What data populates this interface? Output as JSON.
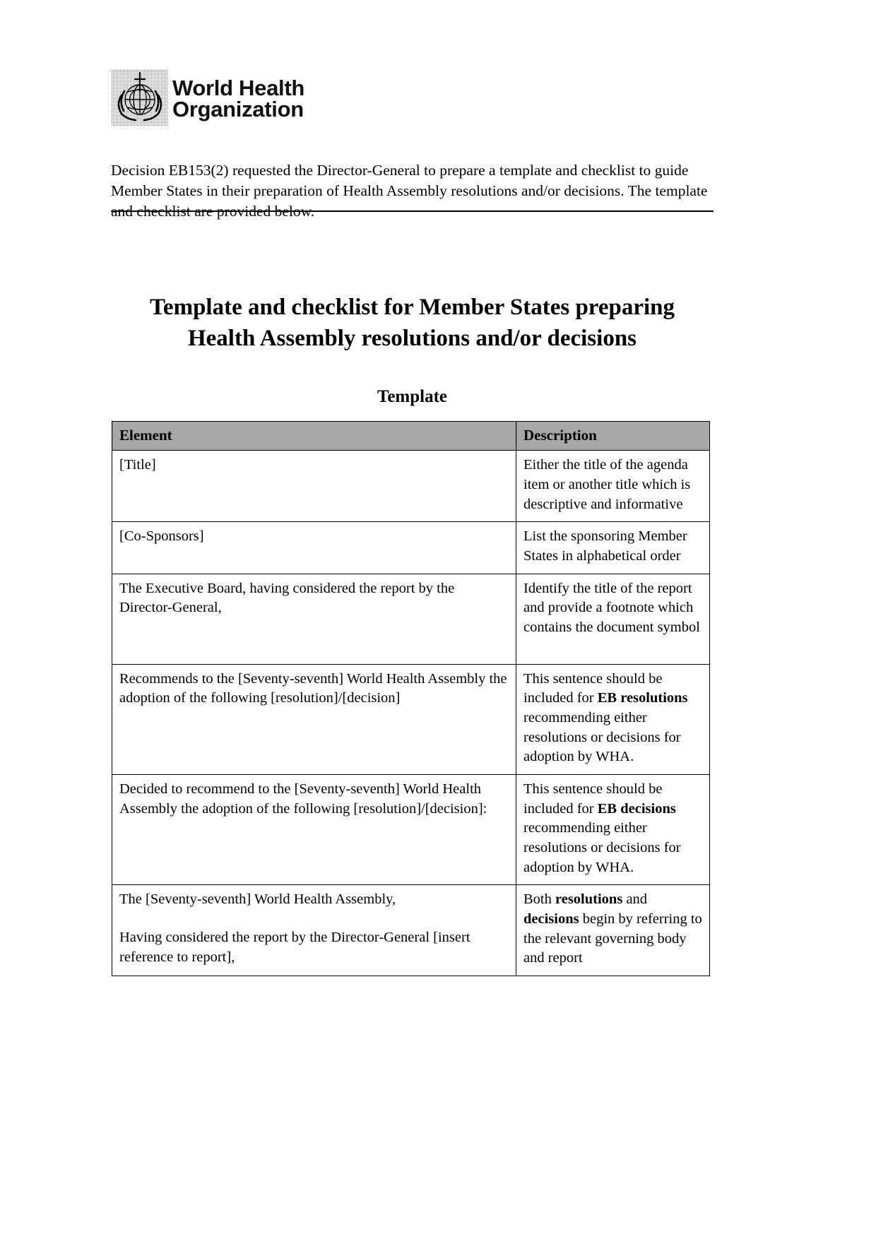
{
  "logo": {
    "emblem_name": "who-emblem",
    "line1": "World Health",
    "line2": "Organization"
  },
  "intro": {
    "paragraph": "Decision EB153(2) requested the Director-General to prepare a template and checklist to guide Member States in their preparation of Health Assembly resolutions and/or decisions. The template and checklist are provided below."
  },
  "title": {
    "line1": "Template and checklist for Member States preparing",
    "line2": "Health Assembly resolutions and/or decisions"
  },
  "subtitle": "Template",
  "table": {
    "headers": {
      "element": "Element",
      "description": "Description"
    },
    "rows": [
      {
        "element": "[Title]",
        "description_pre": "Either the title of the agenda item or another title which is descriptive and informative",
        "description_bold": "",
        "description_post": ""
      },
      {
        "element": "[Co-Sponsors]",
        "description_pre": "List the sponsoring Member States in alphabetical order",
        "description_bold": "",
        "description_post": ""
      },
      {
        "element": "The Executive Board, having considered the report by the Director-General,",
        "description_pre": "Identify the title of the report and provide a footnote which contains the document symbol",
        "description_bold": "",
        "description_post": ""
      },
      {
        "element": "Recommends to the [Seventy-seventh] World Health Assembly the adoption of the following [resolution]/[decision]",
        "description_pre": "This sentence should be included for ",
        "description_bold": "EB resolutions",
        "description_post": " recommending either resolutions or decisions for adoption by WHA."
      },
      {
        "element": "Decided to recommend to the [Seventy-seventh] World Health Assembly the adoption of the following [resolution]/[decision]:",
        "description_pre": "This sentence should be included for ",
        "description_bold": "EB decisions",
        "description_post": " recommending either resolutions or decisions for adoption by WHA."
      },
      {
        "element_line1": "The [Seventy-seventh] World Health Assembly,",
        "element_line2": "Having considered the report by the Director-General [insert reference to report],",
        "description_pre": "Both ",
        "description_bold": "resolutions",
        "description_mid": " and ",
        "description_bold2": "decisions",
        "description_post": " begin by referring to the relevant governing body and report"
      }
    ]
  }
}
